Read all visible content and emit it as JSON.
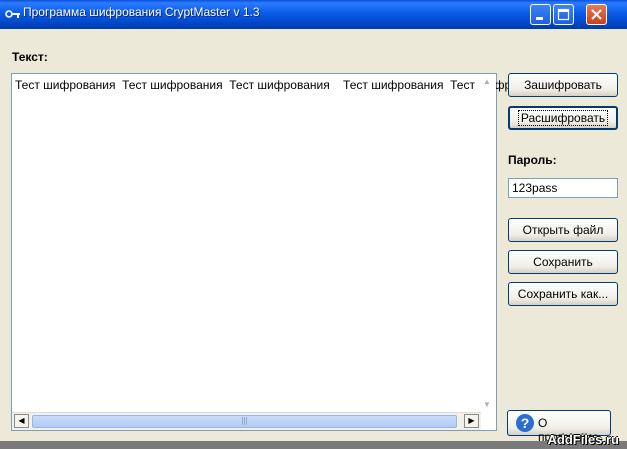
{
  "window": {
    "title": "Программа шифрования CryptMaster v 1.3"
  },
  "main": {
    "text_label": "Текст:",
    "text_value": "Тест шифрования  Тест шифрования  Тест шифрования    Тест шифрования  Тест шифрова"
  },
  "sidebar": {
    "encrypt_label": "Зашифровать",
    "decrypt_label": "Расшифровать",
    "password_label": "Пароль:",
    "password_value": "123pass",
    "open_label": "Открыть файл",
    "save_label": "Сохранить",
    "save_as_label": "Сохранить как...",
    "about_label": "О программе"
  },
  "watermark": "AddFiles.ru",
  "icons": {
    "title": "key-icon",
    "about": "help-icon"
  }
}
